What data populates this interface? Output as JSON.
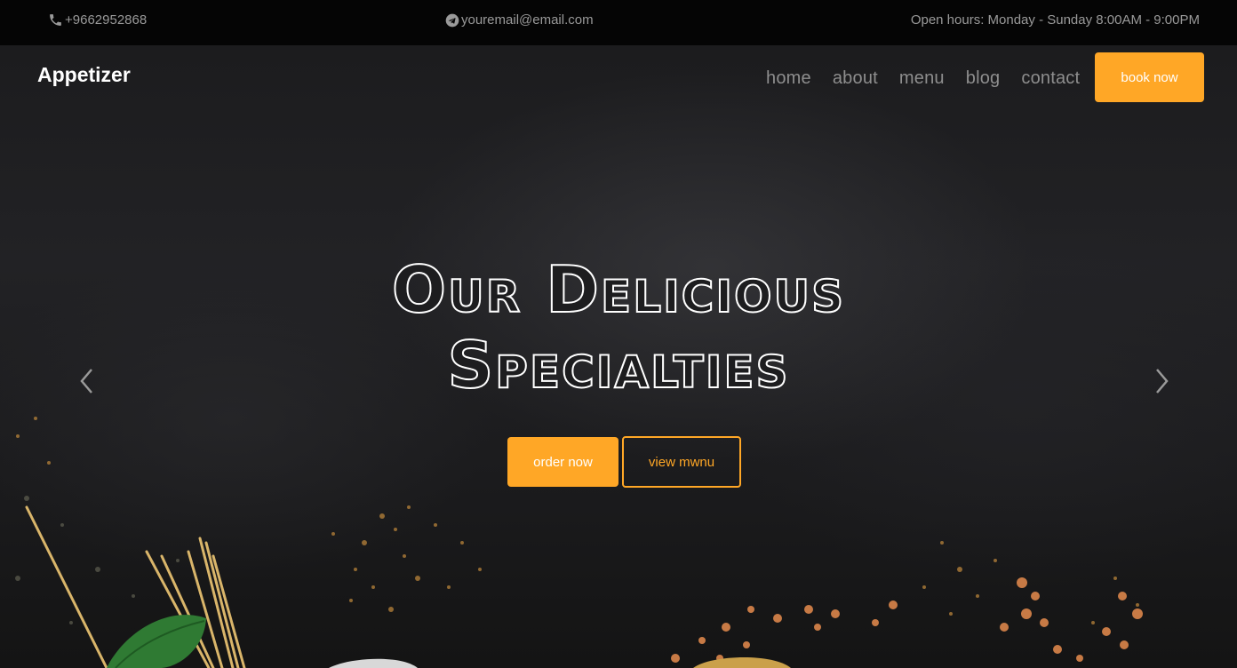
{
  "topbar": {
    "phone": "+9662952868",
    "email": "youremail@email.com",
    "hours": "Open hours: Monday - Sunday 8:00AM - 9:00PM",
    "phone_icon": "phone-icon",
    "email_icon": "send-icon"
  },
  "navbar": {
    "brand": "Appetizer",
    "links": [
      "home",
      "about",
      "menu",
      "blog",
      "contact"
    ],
    "cta": "book now"
  },
  "hero": {
    "headline_line1": "Our Delicious",
    "headline_line2": "Specialties",
    "order_button": "order now",
    "menu_button": "view mwnu",
    "prev_icon": "chevron-left-icon",
    "next_icon": "chevron-right-icon"
  },
  "colors": {
    "accent": "#ffa726",
    "topbar_bg": "#050505",
    "hero_bg": "#1e1e20",
    "nav_text": "#8e8e8e"
  }
}
